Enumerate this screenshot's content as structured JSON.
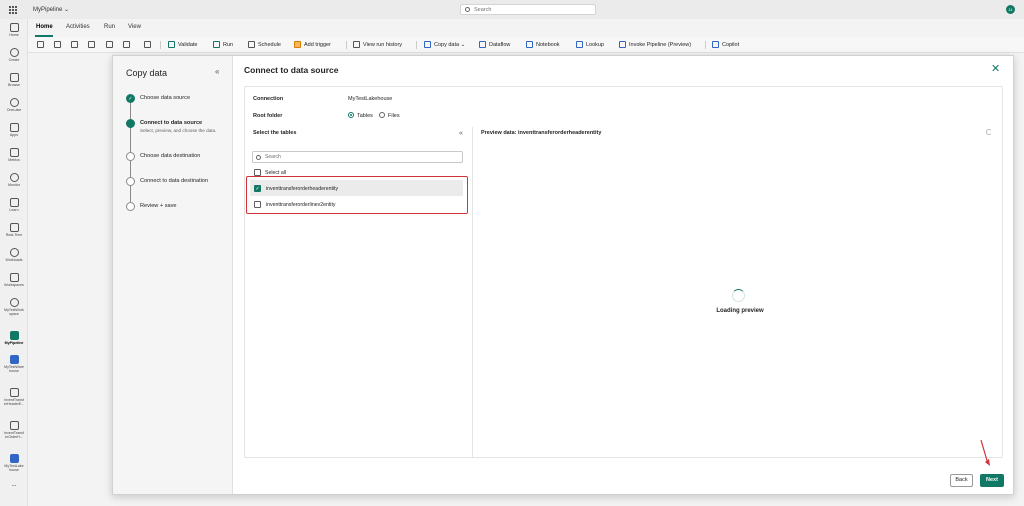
{
  "app": {
    "title": "MyPipeline",
    "search_placeholder": "Search",
    "notification_count": "11"
  },
  "rail": [
    {
      "name": "home",
      "label": "Home"
    },
    {
      "name": "create",
      "label": "Create"
    },
    {
      "name": "browse",
      "label": "Browse"
    },
    {
      "name": "onelake",
      "label": "OneLake"
    },
    {
      "name": "apps",
      "label": "Apps"
    },
    {
      "name": "metrics",
      "label": "Metrics"
    },
    {
      "name": "monitor",
      "label": "Monitor"
    },
    {
      "name": "learn",
      "label": "Learn"
    },
    {
      "name": "realtime",
      "label": "Real-Time"
    },
    {
      "name": "workloads",
      "label": "Workloads"
    },
    {
      "name": "workspaces",
      "label": "Workspaces"
    },
    {
      "name": "mytestworkspace",
      "label": "MyTestWork space"
    },
    {
      "name": "mypipeline",
      "label": "MyPipeline"
    },
    {
      "name": "mytestwarehouse",
      "label": "MyTestWare house"
    },
    {
      "name": "inventtransfer1",
      "label": "InventTransf erHeaderE..."
    },
    {
      "name": "inventtransfer2",
      "label": "InventTransf erOrderH..."
    },
    {
      "name": "mytestlakehouse",
      "label": "MyTestLake house"
    },
    {
      "name": "more",
      "label": "..."
    }
  ],
  "tabs": [
    "Home",
    "Activities",
    "Run",
    "View"
  ],
  "ribbon": {
    "validate": "Validate",
    "run": "Run",
    "schedule": "Schedule",
    "add_trigger": "Add trigger",
    "view_run_history": "View run history",
    "copy_data": "Copy data",
    "dataflow": "Dataflow",
    "notebook": "Notebook",
    "lookup": "Lookup",
    "invoke_pipeline": "Invoke Pipeline (Preview)",
    "copilot": "Copilot"
  },
  "wizard": {
    "title": "Copy data",
    "steps": [
      {
        "label": "Choose data source",
        "sub": ""
      },
      {
        "label": "Connect to data source",
        "sub": "Select, preview, and choose the data."
      },
      {
        "label": "Choose data destination",
        "sub": ""
      },
      {
        "label": "Connect to data destination",
        "sub": ""
      },
      {
        "label": "Review + save",
        "sub": ""
      }
    ]
  },
  "main": {
    "title": "Connect to data source",
    "connection_label": "Connection",
    "connection_value": "MyTestLakehouse",
    "root_folder_label": "Root folder",
    "root_options": [
      "Tables",
      "Files"
    ],
    "select_tables_title": "Select the tables",
    "search_placeholder": "Search",
    "select_all": "Select all",
    "tables": [
      "inventtransferorderheaderentity",
      "inventtransferorderlinev2entity"
    ],
    "preview_title": "Preview data: inventtransferorderheaderentity",
    "loading_text": "Loading preview",
    "back_label": "Back",
    "next_label": "Next"
  }
}
